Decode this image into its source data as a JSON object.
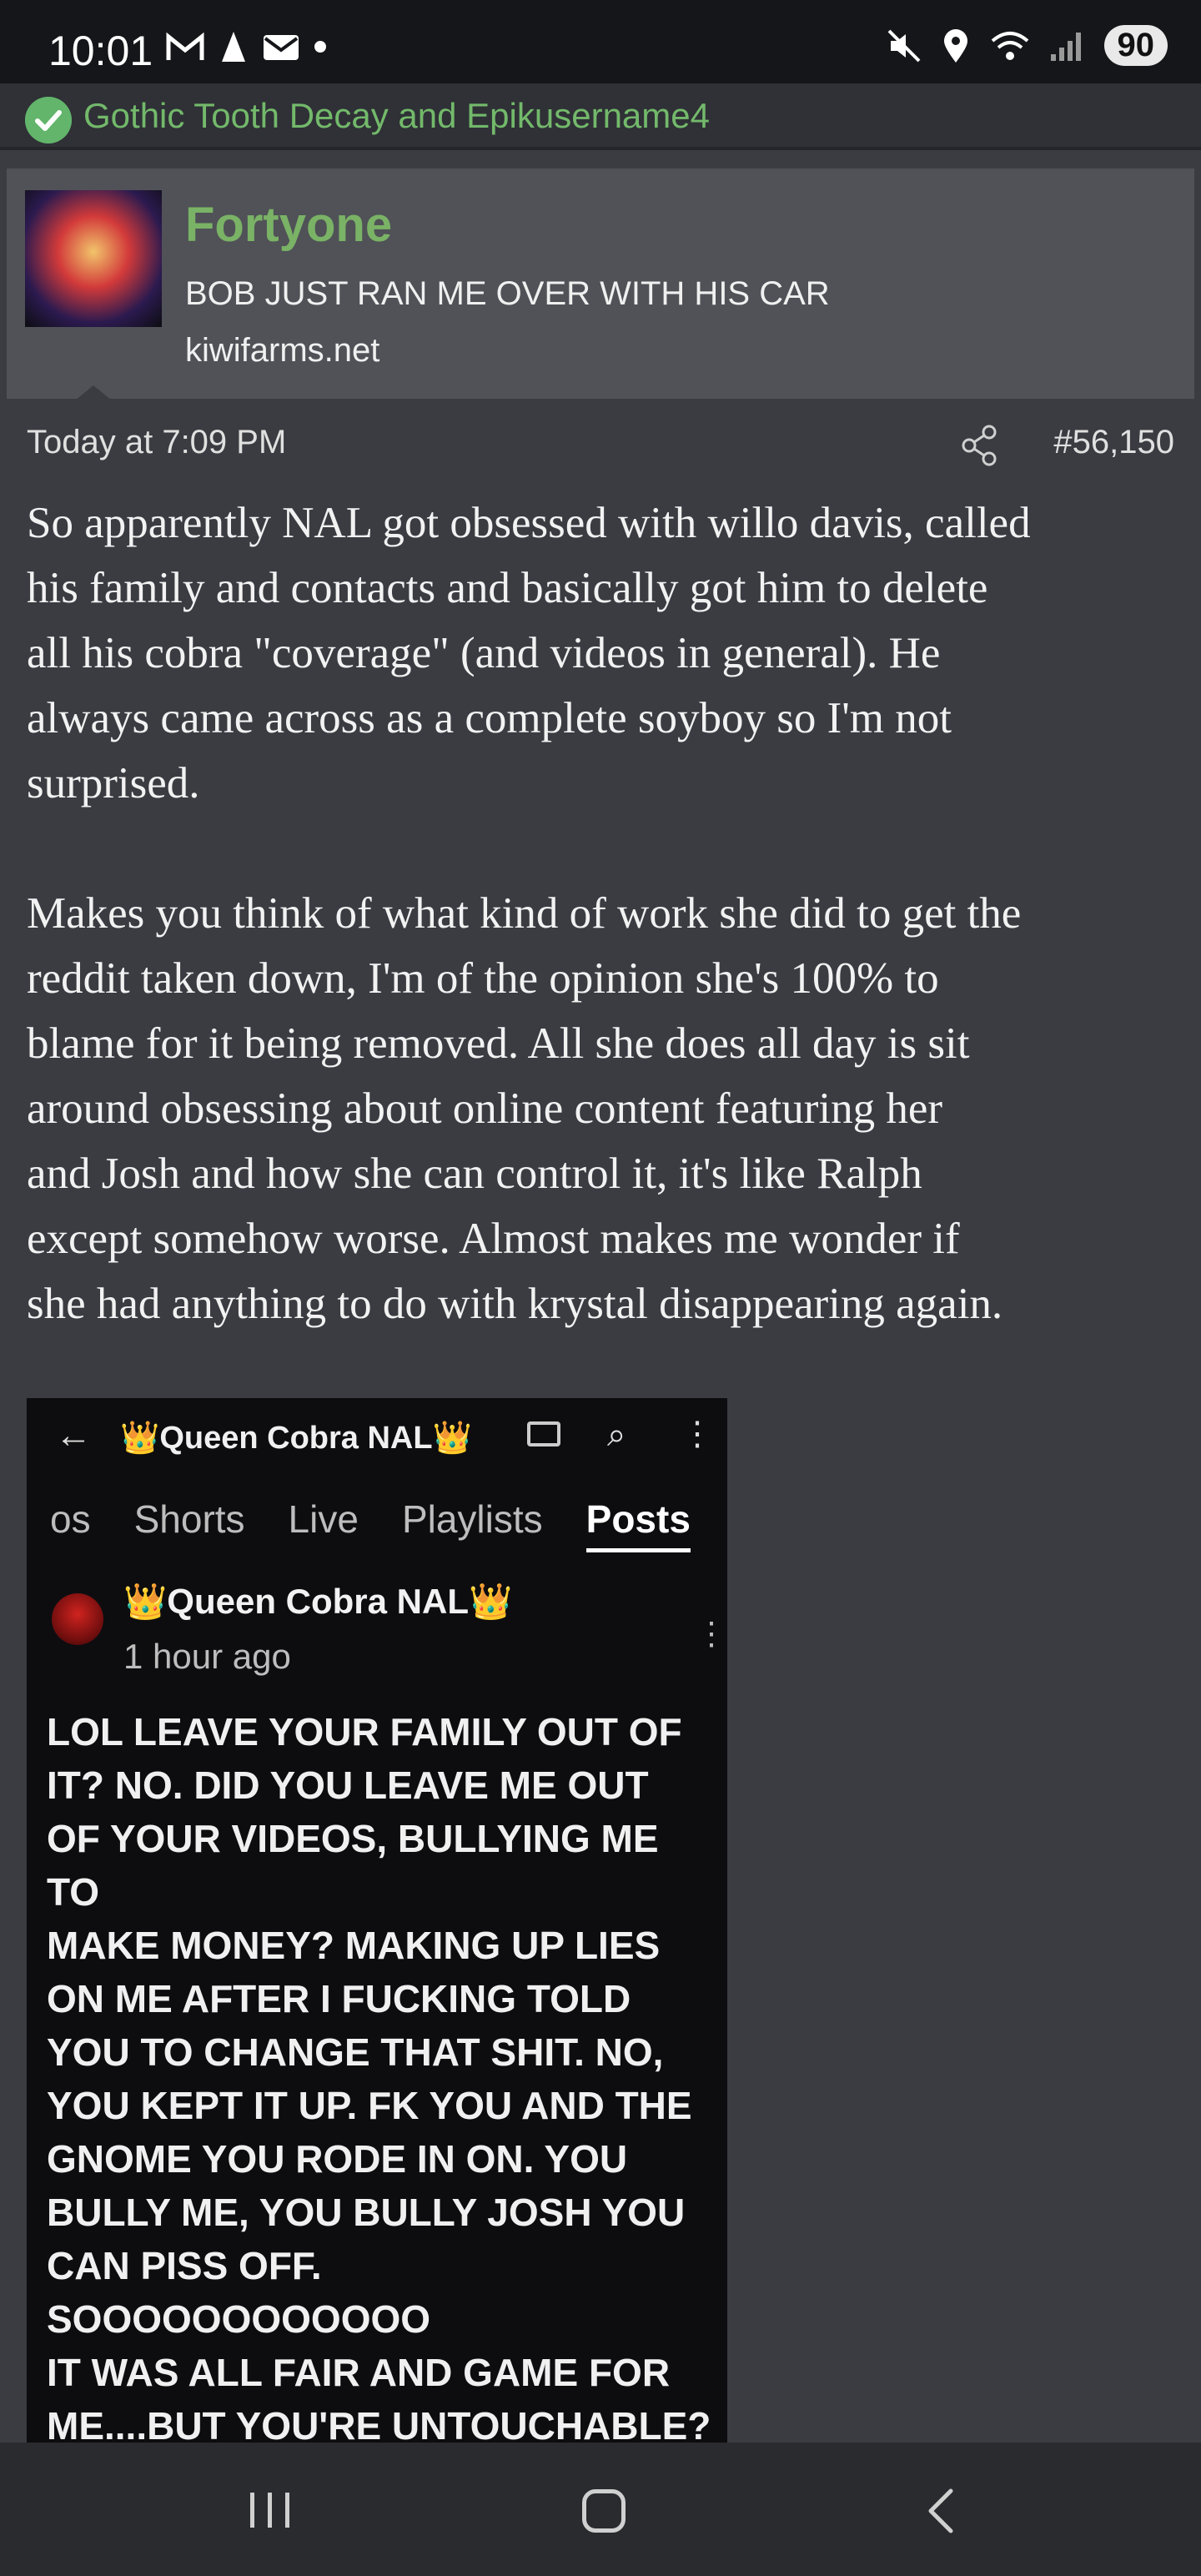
{
  "status_bar": {
    "time": "10:01",
    "battery": "90",
    "left_icons": [
      "gmail-icon",
      "app-icon",
      "mail-icon",
      "dot-icon"
    ],
    "right_icons": [
      "mute-icon",
      "location-icon",
      "wifi-icon",
      "signal-icon"
    ]
  },
  "quote": {
    "text": "Gothic Tooth Decay and Epikusername4"
  },
  "link_card": {
    "title": "Fortyone",
    "subtitle": "BOB JUST RAN ME OVER WITH HIS CAR",
    "domain": "kiwifarms.net",
    "thumb_text": ""
  },
  "post": {
    "time": "Today at 7:09 PM",
    "number": "#56,150",
    "paragraphs": [
      "So apparently NAL got obsessed with willo davis, called\nhis family and contacts and basically got him to delete\nall his cobra \"coverage\" (and videos in general). He\nalways came across as a complete soyboy so I'm not\nsurprised.",
      "Makes you think of what kind of work she did to get the\nreddit taken down, I'm of the opinion she's 100% to\nblame for it being removed. All she does all day is sit\naround obsessing about online content featuring her\nand Josh and how she can control it, it's like Ralph\nexcept somehow worse. Almost makes me wonder if\nshe had anything to do with krystal disappearing again."
    ]
  },
  "embedded_screenshot": {
    "channel_title": "👑Queen Cobra NAL👑",
    "tabs": [
      "os",
      "Shorts",
      "Live",
      "Playlists",
      "Posts"
    ],
    "active_tab": "Posts",
    "author": "👑Queen Cobra NAL👑",
    "time_ago": "1 hour ago",
    "text": "LOL LEAVE YOUR FAMILY OUT OF\nIT?  NO.  DID YOU LEAVE ME OUT\nOF YOUR VIDEOS, BULLYING ME TO\nMAKE MONEY?  MAKING UP LIES\nON ME AFTER I FUCKING TOLD\nYOU TO CHANGE THAT SHIT.  NO,\nYOU KEPT IT UP.  FK YOU AND THE\nGNOME YOU RODE IN ON.  YOU\nBULLY ME, YOU BULLY JOSH YOU\nCAN PISS OFF.  SOOOOOOOOOOOO\nIT WAS ALL FAIR AND GAME FOR\nME....BUT YOU'RE UNTOUCHABLE?\nGET FKED."
  },
  "colors": {
    "background": "#3a3c42",
    "card": "#505257",
    "accent_green": "#7ab266",
    "statusbar": "#151619"
  }
}
